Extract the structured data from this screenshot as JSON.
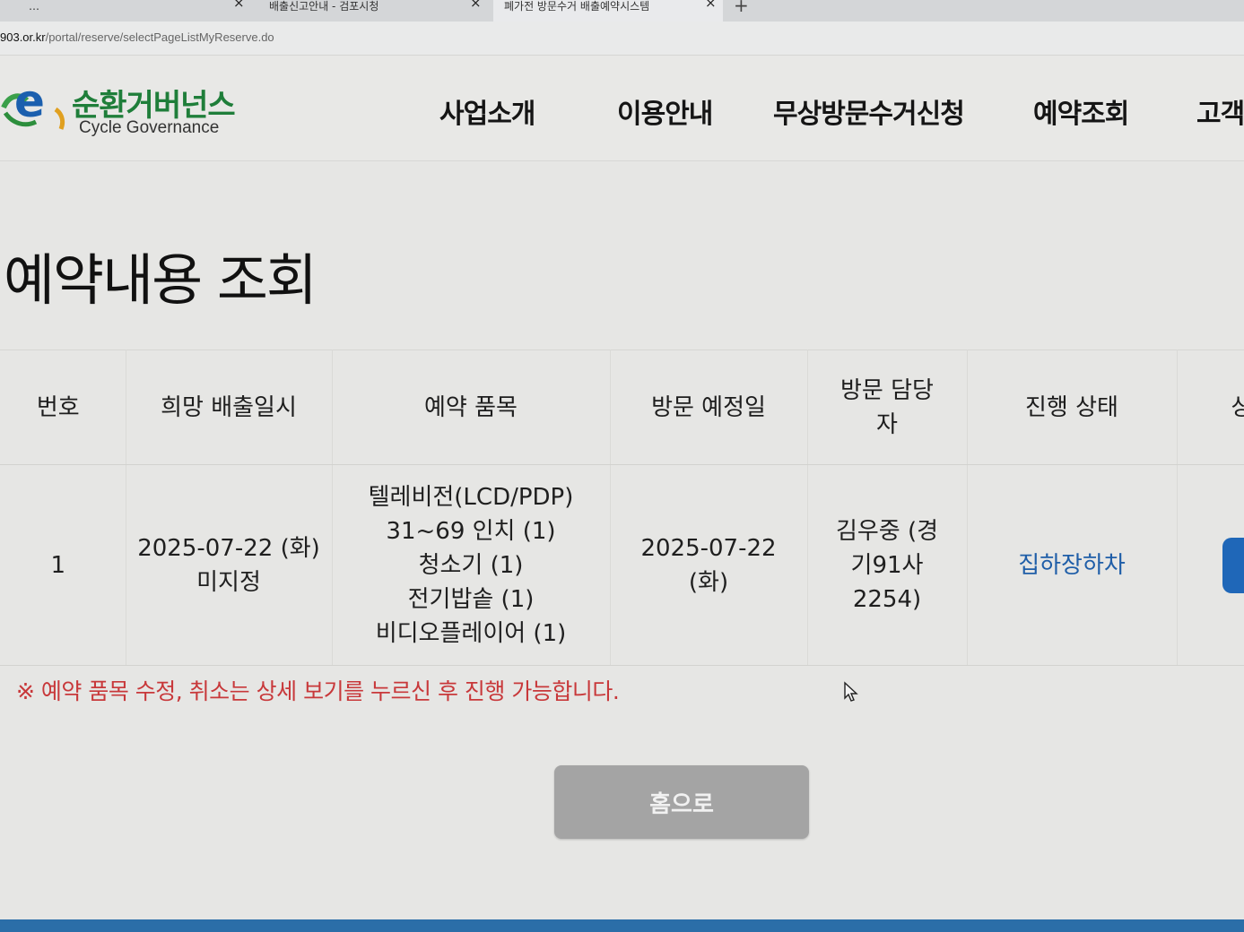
{
  "browser": {
    "tabs": [
      {
        "label": "…",
        "active": false
      },
      {
        "label": "배출신고안내 - 검포시청",
        "active": false
      },
      {
        "label": "폐가전 방문수거 배출예약시스템",
        "active": true
      }
    ],
    "close_glyph": "×",
    "new_tab_glyph": "+",
    "url_host": "903.or.kr",
    "url_path": "/portal/reserve/selectPageListMyReserve.do"
  },
  "header": {
    "logo_kor": "순환거버넌스",
    "logo_eng": "Cycle Governance",
    "nav": [
      "사업소개",
      "이용안내",
      "무상방문수거신청",
      "예약조회",
      "고객"
    ]
  },
  "page_title": "예약내용 조회",
  "table": {
    "headers": [
      "번호",
      "희망 배출일시",
      "예약 품목",
      "방문 예정일",
      "방문 담당자",
      "진행 상태",
      "상세"
    ],
    "rows": [
      {
        "num": "1",
        "desired_date": "2025-07-22 (화)",
        "desired_time": "미지정",
        "items": [
          "텔레비전(LCD/PDP)",
          "31~69 인치 (1)",
          "청소기 (1)",
          "전기밥솥 (1)",
          "비디오플레이어 (1)"
        ],
        "visit_date": "2025-07-22",
        "visit_day": "(화)",
        "staff_name": "김우중 (경",
        "staff_car": "기91사",
        "staff_num": "2254)",
        "status": "집하장하차",
        "detail_label": "상세"
      }
    ]
  },
  "notice": "※ 예약 품목 수정, 취소는 상세 보기를 누르신 후 진행 가능합니다.",
  "home_button": "홈으로",
  "colors": {
    "brand_green": "#1f7e3a",
    "link_blue": "#1f5ea8",
    "detail_button": "#1f67b8",
    "notice_red": "#c8383a",
    "home_button_bg": "#a4a4a4"
  }
}
